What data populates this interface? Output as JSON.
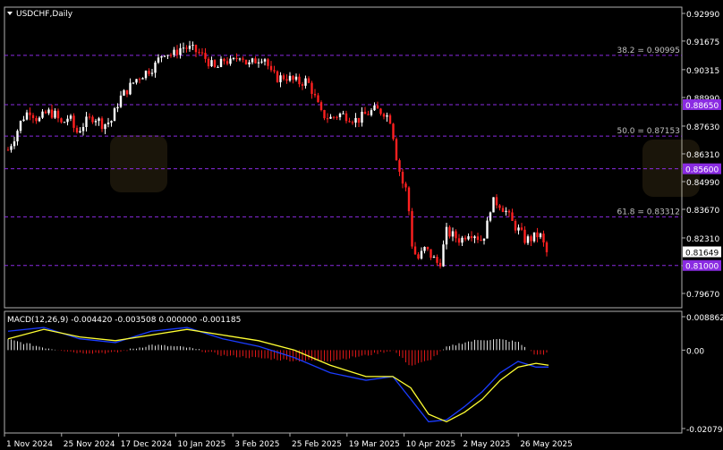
{
  "symbol_label": "USDCHF,Daily",
  "colors": {
    "background": "#000000",
    "up": "#ffffff",
    "down": "#ff2020",
    "frame": "#b0b0b0",
    "level": "#8a2be2",
    "fib_text": "#c0c0c0",
    "macd_line": "#1a3cff",
    "signal_line": "#ffff33",
    "hist_pos": "#e0e0e0",
    "hist_neg": "#e01818"
  },
  "price_axis": {
    "ticks": [
      "0.92990",
      "0.91675",
      "0.90315",
      "0.88990",
      "0.87630",
      "0.86310",
      "0.84990",
      "0.83670",
      "0.82310",
      "0.80990",
      "0.79670"
    ],
    "current_price": "0.81649"
  },
  "levels": [
    {
      "value": 0.90995,
      "label": "38.2 = 0.90995",
      "axis_label": ""
    },
    {
      "value": 0.8865,
      "label": "",
      "axis_label": "0.88650"
    },
    {
      "value": 0.87153,
      "label": "50.0 = 0.87153",
      "axis_label": ""
    },
    {
      "value": 0.856,
      "label": "",
      "axis_label": "0.85600"
    },
    {
      "value": 0.83312,
      "label": "61.8 = 0.83312",
      "axis_label": ""
    },
    {
      "value": 0.81,
      "label": "",
      "axis_label": "0.81000"
    }
  ],
  "macd_panel": {
    "label": "MACD(12,26,9) -0.004420 -0.003508 0.000000 -0.001185",
    "ticks": [
      "0.008862",
      "0.00",
      "-0.020794"
    ]
  },
  "x_axis_labels": [
    "1 Nov 2024",
    "25 Nov 2024",
    "17 Dec 2024",
    "10 Jan 2025",
    "3 Feb 2025",
    "25 Feb 2025",
    "19 Mar 2025",
    "10 Apr 2025",
    "2 May 2025",
    "26 May 2025"
  ],
  "chart_data": {
    "type": "candlestick",
    "title": "USDCHF,Daily",
    "ylim": [
      0.7967,
      0.9299
    ],
    "close_points": [
      [
        0,
        0.865
      ],
      [
        8,
        0.872
      ],
      [
        16,
        0.88
      ],
      [
        24,
        0.884
      ],
      [
        34,
        0.879
      ],
      [
        44,
        0.883
      ],
      [
        52,
        0.882
      ],
      [
        60,
        0.877
      ],
      [
        68,
        0.881
      ],
      [
        76,
        0.873
      ],
      [
        86,
        0.878
      ],
      [
        96,
        0.881
      ],
      [
        106,
        0.877
      ],
      [
        116,
        0.879
      ],
      [
        124,
        0.889
      ],
      [
        134,
        0.894
      ],
      [
        144,
        0.899
      ],
      [
        154,
        0.902
      ],
      [
        164,
        0.905
      ],
      [
        174,
        0.912
      ],
      [
        184,
        0.91
      ],
      [
        194,
        0.914
      ],
      [
        204,
        0.913
      ],
      [
        214,
        0.911
      ],
      [
        222,
        0.908
      ],
      [
        232,
        0.903
      ],
      [
        242,
        0.908
      ],
      [
        250,
        0.906
      ],
      [
        260,
        0.911
      ],
      [
        268,
        0.905
      ],
      [
        278,
        0.908
      ],
      [
        286,
        0.91
      ],
      [
        294,
        0.901
      ],
      [
        302,
        0.899
      ],
      [
        310,
        0.9
      ],
      [
        318,
        0.898
      ],
      [
        326,
        0.897
      ],
      [
        334,
        0.898
      ],
      [
        340,
        0.893
      ],
      [
        350,
        0.882
      ],
      [
        360,
        0.88
      ],
      [
        370,
        0.882
      ],
      [
        380,
        0.881
      ],
      [
        390,
        0.879
      ],
      [
        400,
        0.882
      ],
      [
        410,
        0.884
      ],
      [
        420,
        0.883
      ],
      [
        428,
        0.879
      ],
      [
        434,
        0.862
      ],
      [
        440,
        0.85
      ],
      [
        446,
        0.845
      ],
      [
        452,
        0.818
      ],
      [
        458,
        0.813
      ],
      [
        466,
        0.818
      ],
      [
        474,
        0.814
      ],
      [
        482,
        0.81
      ],
      [
        490,
        0.826
      ],
      [
        498,
        0.824
      ],
      [
        506,
        0.822
      ],
      [
        514,
        0.826
      ],
      [
        522,
        0.825
      ],
      [
        528,
        0.822
      ],
      [
        534,
        0.826
      ],
      [
        540,
        0.84
      ],
      [
        548,
        0.84
      ],
      [
        556,
        0.836
      ],
      [
        564,
        0.83
      ],
      [
        572,
        0.826
      ],
      [
        578,
        0.822
      ],
      [
        586,
        0.823
      ],
      [
        594,
        0.825
      ],
      [
        602,
        0.816
      ]
    ],
    "macd_points": [
      [
        0,
        0.005
      ],
      [
        40,
        0.006
      ],
      [
        80,
        0.003
      ],
      [
        120,
        0.002
      ],
      [
        160,
        0.005
      ],
      [
        200,
        0.006
      ],
      [
        240,
        0.003
      ],
      [
        280,
        0.001
      ],
      [
        320,
        -0.002
      ],
      [
        360,
        -0.006
      ],
      [
        400,
        -0.008
      ],
      [
        430,
        -0.007
      ],
      [
        450,
        -0.013
      ],
      [
        470,
        -0.019
      ],
      [
        490,
        -0.0185
      ],
      [
        510,
        -0.015
      ],
      [
        530,
        -0.011
      ],
      [
        550,
        -0.006
      ],
      [
        570,
        -0.003
      ],
      [
        590,
        -0.0045
      ],
      [
        604,
        -0.0045
      ]
    ],
    "signal_points": [
      [
        0,
        0.003
      ],
      [
        40,
        0.0055
      ],
      [
        80,
        0.0035
      ],
      [
        120,
        0.0025
      ],
      [
        160,
        0.004
      ],
      [
        200,
        0.0055
      ],
      [
        240,
        0.004
      ],
      [
        280,
        0.0025
      ],
      [
        320,
        0.0
      ],
      [
        360,
        -0.004
      ],
      [
        400,
        -0.007
      ],
      [
        430,
        -0.007
      ],
      [
        450,
        -0.01
      ],
      [
        470,
        -0.017
      ],
      [
        490,
        -0.019
      ],
      [
        510,
        -0.0165
      ],
      [
        530,
        -0.013
      ],
      [
        550,
        -0.008
      ],
      [
        570,
        -0.0045
      ],
      [
        590,
        -0.0035
      ],
      [
        604,
        -0.004
      ]
    ]
  }
}
